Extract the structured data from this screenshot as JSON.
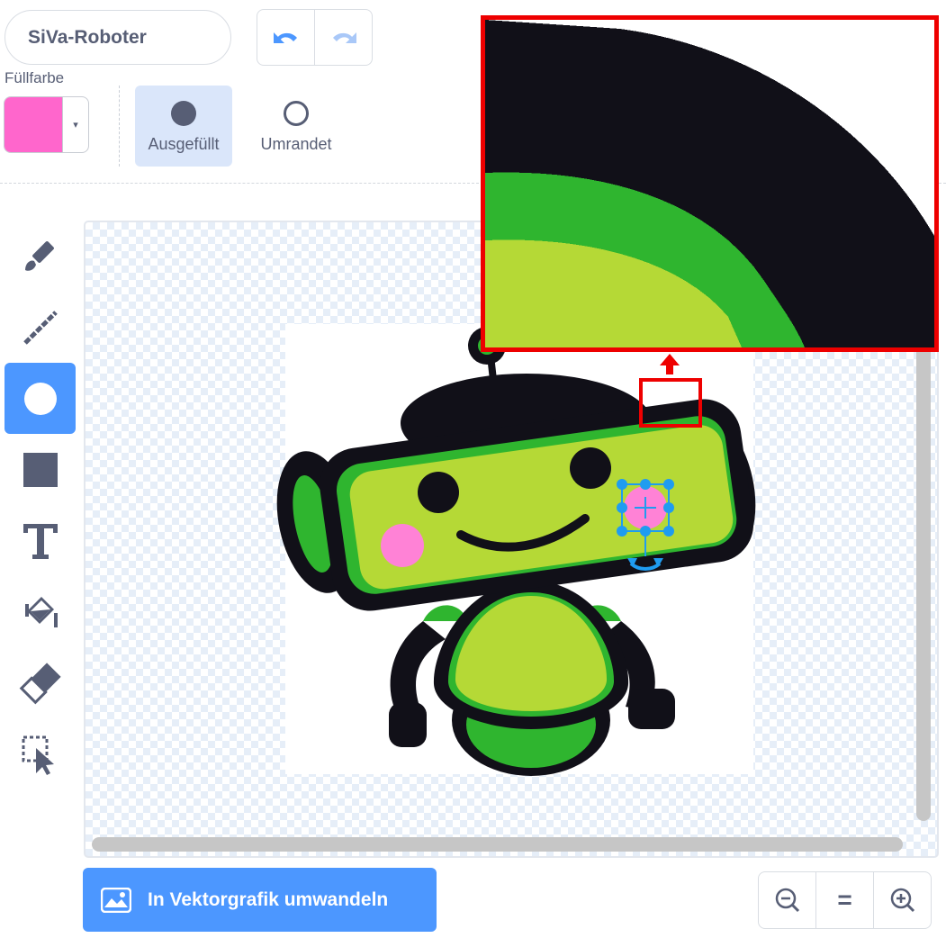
{
  "costume": {
    "name": "SiVa-Roboter"
  },
  "history": {
    "undo": "undo-icon",
    "redo": "redo-icon"
  },
  "fill": {
    "label": "Füllfarbe",
    "color": "#ff66cc",
    "dropdown_arrow": "▾"
  },
  "modes": {
    "filled_label": "Ausgefüllt",
    "outlined_label": "Umrandet",
    "selected": "filled"
  },
  "tools": [
    {
      "name": "brush",
      "icon": "brush-icon"
    },
    {
      "name": "line",
      "icon": "line-icon"
    },
    {
      "name": "circle",
      "icon": "circle-icon",
      "active": true
    },
    {
      "name": "rectangle",
      "icon": "rectangle-icon"
    },
    {
      "name": "text",
      "icon": "text-icon"
    },
    {
      "name": "fill",
      "icon": "paint-bucket-icon"
    },
    {
      "name": "eraser",
      "icon": "eraser-icon"
    },
    {
      "name": "select",
      "icon": "select-icon"
    }
  ],
  "convert": {
    "label": "In Vektorgrafik umwandeln",
    "icon": "image-icon"
  },
  "zoom": {
    "out": "zoom-out-icon",
    "reset": "=",
    "in": "zoom-in-icon"
  },
  "colors": {
    "accent": "#4c97ff",
    "highlight": "#ee0000",
    "robot_green": "#b5d936",
    "robot_dark": "#111018"
  }
}
